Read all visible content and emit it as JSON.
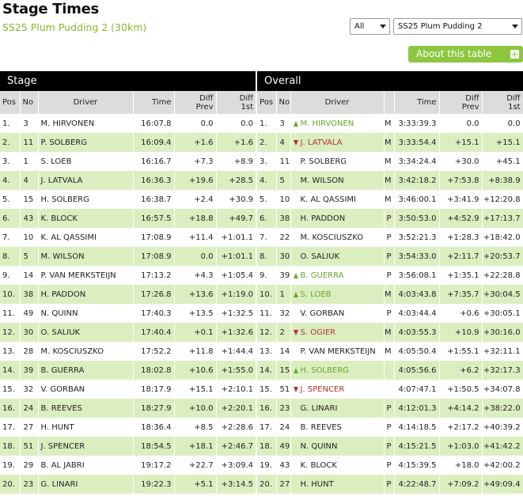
{
  "header": {
    "title": "Stage Times",
    "subtitle": "SS25 Plum Pudding 2 (30km)",
    "category_select": "All",
    "stage_select": "SS25 Plum Pudding 2",
    "about_button": "About this table"
  },
  "sections": {
    "stage": "Stage",
    "overall": "Overall"
  },
  "columns": {
    "pos": "Pos",
    "no": "No",
    "driver": "Driver",
    "time": "Time",
    "diff_prev": [
      "Diff",
      "Prev"
    ],
    "diff_1st": [
      "Diff",
      "1st"
    ]
  },
  "stage_rows": [
    {
      "pos": "1.",
      "no": "3",
      "driver": "M. HIRVONEN",
      "time": "16:07.8",
      "diff_prev": "0.0",
      "diff_1st": "0.0"
    },
    {
      "pos": "2.",
      "no": "11",
      "driver": "P. SOLBERG",
      "time": "16:09.4",
      "diff_prev": "+1.6",
      "diff_1st": "+1.6"
    },
    {
      "pos": "3.",
      "no": "1",
      "driver": "S. LOEB",
      "time": "16:16.7",
      "diff_prev": "+7.3",
      "diff_1st": "+8.9"
    },
    {
      "pos": "4.",
      "no": "4",
      "driver": "J. LATVALA",
      "time": "16:36.3",
      "diff_prev": "+19.6",
      "diff_1st": "+28.5"
    },
    {
      "pos": "5.",
      "no": "15",
      "driver": "H. SOLBERG",
      "time": "16:38.7",
      "diff_prev": "+2.4",
      "diff_1st": "+30.9"
    },
    {
      "pos": "6.",
      "no": "43",
      "driver": "K. BLOCK",
      "time": "16:57.5",
      "diff_prev": "+18.8",
      "diff_1st": "+49.7"
    },
    {
      "pos": "7.",
      "no": "10",
      "driver": "K. AL QASSIMI",
      "time": "17:08.9",
      "diff_prev": "+11.4",
      "diff_1st": "+1:01.1"
    },
    {
      "pos": "8.",
      "no": "5",
      "driver": "M. WILSON",
      "time": "17:08.9",
      "diff_prev": "0.0",
      "diff_1st": "+1:01.1"
    },
    {
      "pos": "9.",
      "no": "14",
      "driver": "P. VAN MERKSTEIJN",
      "time": "17:13.2",
      "diff_prev": "+4.3",
      "diff_1st": "+1:05.4"
    },
    {
      "pos": "10.",
      "no": "38",
      "driver": "H. PADDON",
      "time": "17:26.8",
      "diff_prev": "+13.6",
      "diff_1st": "+1:19.0"
    },
    {
      "pos": "11.",
      "no": "49",
      "driver": "N. QUINN",
      "time": "17:40.3",
      "diff_prev": "+13.5",
      "diff_1st": "+1:32.5"
    },
    {
      "pos": "12.",
      "no": "30",
      "driver": "O. SALIUK",
      "time": "17:40.4",
      "diff_prev": "+0.1",
      "diff_1st": "+1:32.6"
    },
    {
      "pos": "13.",
      "no": "28",
      "driver": "M. KOSCIUSZKO",
      "time": "17:52.2",
      "diff_prev": "+11.8",
      "diff_1st": "+1:44.4"
    },
    {
      "pos": "14.",
      "no": "39",
      "driver": "B. GUERRA",
      "time": "18:02.8",
      "diff_prev": "+10.6",
      "diff_1st": "+1:55.0"
    },
    {
      "pos": "15.",
      "no": "32",
      "driver": "V. GORBAN",
      "time": "18:17.9",
      "diff_prev": "+15.1",
      "diff_1st": "+2:10.1"
    },
    {
      "pos": "16.",
      "no": "24",
      "driver": "B. REEVES",
      "time": "18:27.9",
      "diff_prev": "+10.0",
      "diff_1st": "+2:20.1"
    },
    {
      "pos": "17.",
      "no": "27",
      "driver": "H. HUNT",
      "time": "18:36.4",
      "diff_prev": "+8.5",
      "diff_1st": "+2:28.6"
    },
    {
      "pos": "18.",
      "no": "51",
      "driver": "J. SPENCER",
      "time": "18:54.5",
      "diff_prev": "+18.1",
      "diff_1st": "+2:46.7"
    },
    {
      "pos": "19.",
      "no": "29",
      "driver": "B. AL JABRI",
      "time": "19:17.2",
      "diff_prev": "+22.7",
      "diff_1st": "+3:09.4"
    },
    {
      "pos": "20.",
      "no": "23",
      "driver": "G. LINARI",
      "time": "19:22.3",
      "diff_prev": "+5.1",
      "diff_1st": "+3:14.5"
    }
  ],
  "overall_rows": [
    {
      "pos": "1.",
      "no": "3",
      "driver": "M. HIRVONEN",
      "trend": "up",
      "cls": "M",
      "time": "3:33:39.3",
      "diff_prev": "0.0",
      "diff_1st": "0.0"
    },
    {
      "pos": "2.",
      "no": "4",
      "driver": "J. LATVALA",
      "trend": "down",
      "cls": "M",
      "time": "3:33:54.4",
      "diff_prev": "+15.1",
      "diff_1st": "+15.1"
    },
    {
      "pos": "3.",
      "no": "11",
      "driver": "P. SOLBERG",
      "trend": "",
      "cls": "M",
      "time": "3:34:24.4",
      "diff_prev": "+30.0",
      "diff_1st": "+45.1"
    },
    {
      "pos": "4.",
      "no": "5",
      "driver": "M. WILSON",
      "trend": "",
      "cls": "M",
      "time": "3:42:18.2",
      "diff_prev": "+7:53.8",
      "diff_1st": "+8:38.9"
    },
    {
      "pos": "5.",
      "no": "10",
      "driver": "K. AL QASSIMI",
      "trend": "",
      "cls": "M",
      "time": "3:46:00.1",
      "diff_prev": "+3:41.9",
      "diff_1st": "+12:20.8"
    },
    {
      "pos": "6.",
      "no": "38",
      "driver": "H. PADDON",
      "trend": "",
      "cls": "P",
      "time": "3:50:53.0",
      "diff_prev": "+4:52.9",
      "diff_1st": "+17:13.7"
    },
    {
      "pos": "7.",
      "no": "22",
      "driver": "M. KOSCIUSZKO",
      "trend": "",
      "cls": "P",
      "time": "3:52:21.3",
      "diff_prev": "+1:28.3",
      "diff_1st": "+18:42.0"
    },
    {
      "pos": "8.",
      "no": "30",
      "driver": "O. SALIUK",
      "trend": "",
      "cls": "P",
      "time": "3:54:33.0",
      "diff_prev": "+2:11.7",
      "diff_1st": "+20:53.7"
    },
    {
      "pos": "9.",
      "no": "39",
      "driver": "B. GUERRA",
      "trend": "up",
      "cls": "P",
      "time": "3:56:08.1",
      "diff_prev": "+1:35.1",
      "diff_1st": "+22:28.8"
    },
    {
      "pos": "10.",
      "no": "1",
      "driver": "S. LOEB",
      "trend": "up",
      "cls": "M",
      "time": "4:03:43.8",
      "diff_prev": "+7:35.7",
      "diff_1st": "+30:04.5"
    },
    {
      "pos": "11.",
      "no": "32",
      "driver": "V. GORBAN",
      "trend": "",
      "cls": "P",
      "time": "4:03:44.4",
      "diff_prev": "+0.6",
      "diff_1st": "+30:05.1"
    },
    {
      "pos": "12.",
      "no": "2",
      "driver": "S. OGIER",
      "trend": "down",
      "cls": "M",
      "time": "4:03:55.3",
      "diff_prev": "+10.9",
      "diff_1st": "+30:16.0"
    },
    {
      "pos": "13.",
      "no": "14",
      "driver": "P. VAN MERKSTEIJN",
      "trend": "",
      "cls": "M",
      "time": "4:05:50.4",
      "diff_prev": "+1:55.1",
      "diff_1st": "+32:11.1"
    },
    {
      "pos": "14.",
      "no": "15",
      "driver": "H. SOLBERG",
      "trend": "up",
      "cls": "",
      "time": "4:05:56.6",
      "diff_prev": "+6.2",
      "diff_1st": "+32:17.3"
    },
    {
      "pos": "15.",
      "no": "51",
      "driver": "J. SPENCER",
      "trend": "down",
      "cls": "",
      "time": "4:07:47.1",
      "diff_prev": "+1:50.5",
      "diff_1st": "+34:07.8"
    },
    {
      "pos": "16.",
      "no": "23",
      "driver": "G. LINARI",
      "trend": "",
      "cls": "P",
      "time": "4:12:01.3",
      "diff_prev": "+4:14.2",
      "diff_1st": "+38:22.0"
    },
    {
      "pos": "17.",
      "no": "24",
      "driver": "B. REEVES",
      "trend": "",
      "cls": "P",
      "time": "4:14:18.5",
      "diff_prev": "+2:17.2",
      "diff_1st": "+40:39.2"
    },
    {
      "pos": "18.",
      "no": "49",
      "driver": "N. QUINN",
      "trend": "",
      "cls": "P",
      "time": "4:15:21.5",
      "diff_prev": "+1:03.0",
      "diff_1st": "+41:42.2"
    },
    {
      "pos": "19.",
      "no": "43",
      "driver": "K. BLOCK",
      "trend": "",
      "cls": "P",
      "time": "4:15:39.5",
      "diff_prev": "+18.0",
      "diff_1st": "+42:00.2"
    },
    {
      "pos": "20.",
      "no": "27",
      "driver": "H. HUNT",
      "trend": "",
      "cls": "P",
      "time": "4:22:48.7",
      "diff_prev": "+7:09.2",
      "diff_1st": "+49:09.4"
    }
  ],
  "colors": {
    "accent_green": "#8dc63f",
    "row_alt": "#dbeec0",
    "header_bg": "#000000",
    "col_header_bg": "#dcdcdc",
    "trend_up": "#6aa52a",
    "trend_down": "#b03030"
  }
}
